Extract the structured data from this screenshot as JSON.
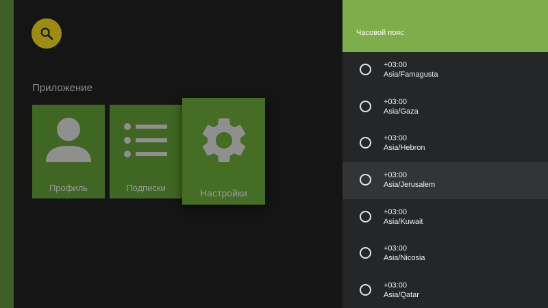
{
  "main": {
    "section_title": "Приложение",
    "tiles": [
      {
        "label": "Профиль",
        "icon": "person-icon"
      },
      {
        "label": "Подписки",
        "icon": "list-icon"
      },
      {
        "label": "Настройки",
        "icon": "gear-icon",
        "focused": true
      }
    ],
    "search": {
      "icon": "search-icon"
    }
  },
  "panel": {
    "title": "Часовой пояс",
    "items": [
      {
        "offset": "+03:00",
        "name": "Asia/Famagusta"
      },
      {
        "offset": "+03:00",
        "name": "Asia/Gaza"
      },
      {
        "offset": "+03:00",
        "name": "Asia/Hebron"
      },
      {
        "offset": "+03:00",
        "name": "Asia/Jerusalem",
        "focused": true
      },
      {
        "offset": "+03:00",
        "name": "Asia/Kuwait"
      },
      {
        "offset": "+03:00",
        "name": "Asia/Nicosia"
      },
      {
        "offset": "+03:00",
        "name": "Asia/Qatar"
      }
    ]
  },
  "colors": {
    "accent": "#7fad4b",
    "tile": "#3f6622",
    "search_button": "#9c8c10",
    "panel_bg": "#252628",
    "background": "#151515"
  }
}
